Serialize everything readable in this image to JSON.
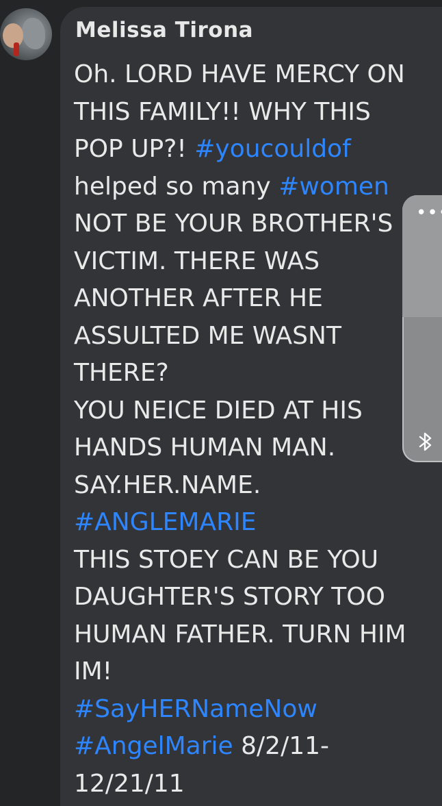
{
  "comment": {
    "author": "Melissa Tirona",
    "lines": [
      [
        {
          "t": "Oh. LORD HAVE MERCY ON",
          "tag": false
        }
      ],
      [
        {
          "t": "THIS FAMILY!! WHY THIS",
          "tag": false
        }
      ],
      [
        {
          "t": "POP UP?! ",
          "tag": false
        },
        {
          "t": "#youcouldof",
          "tag": true
        }
      ],
      [
        {
          "t": "helped so many ",
          "tag": false
        },
        {
          "t": "#women",
          "tag": true
        }
      ],
      [
        {
          "t": "NOT BE YOUR BROTHER'S",
          "tag": false
        }
      ],
      [
        {
          "t": "VICTIM. THERE WAS",
          "tag": false
        }
      ],
      [
        {
          "t": "ANOTHER AFTER HE",
          "tag": false
        }
      ],
      [
        {
          "t": "ASSULTED ME WASNT",
          "tag": false
        }
      ],
      [
        {
          "t": "THERE?",
          "tag": false
        }
      ],
      [
        {
          "t": "YOU NEICE DIED AT HIS",
          "tag": false
        }
      ],
      [
        {
          "t": "HANDS HUMAN MAN.",
          "tag": false
        }
      ],
      [
        {
          "t": "SAY.HER.NAME.",
          "tag": false
        }
      ],
      [
        {
          "t": "#ANGLEMARIE",
          "tag": true
        }
      ],
      [
        {
          "t": "THIS STOEY CAN BE YOU",
          "tag": false
        }
      ],
      [
        {
          "t": "DAUGHTER'S STORY TOO",
          "tag": false
        }
      ],
      [
        {
          "t": "HUMAN FATHER. TURN HIM",
          "tag": false
        }
      ],
      [
        {
          "t": "IM!",
          "tag": false
        }
      ],
      [
        {
          "t": "#SayHERNameNow",
          "tag": true
        }
      ],
      [
        {
          "t": "#AngelMarie",
          "tag": true
        },
        {
          "t": " 8/2/11-",
          "tag": false
        }
      ],
      [
        {
          "t": "12/21/11",
          "tag": false
        }
      ]
    ]
  },
  "side_panel": {
    "menu_icon": "more-dots-icon",
    "menu_glyph": "•••",
    "bluetooth_icon": "bluetooth-icon"
  },
  "colors": {
    "background": "#242527",
    "bubble": "#333437",
    "text": "#e9e9e9",
    "hashtag": "#2d86ff"
  }
}
